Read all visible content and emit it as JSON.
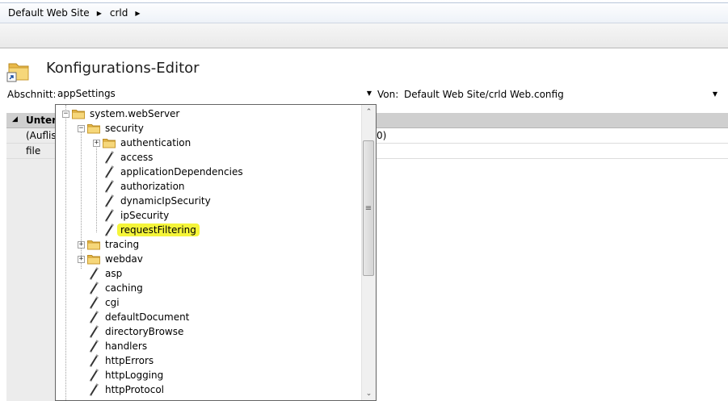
{
  "breadcrumb": [
    "Default Web Site",
    "crld"
  ],
  "feature": {
    "title": "Konfigurations-Editor"
  },
  "section": {
    "label": "Abschnitt:",
    "value": "appSettings"
  },
  "from": {
    "label": "Von:",
    "value": "Default Web Site/crld Web.config"
  },
  "grid": {
    "header": "Unters",
    "rows": [
      {
        "name": "(Auflist",
        "value": "0)"
      },
      {
        "name": "file",
        "value": ""
      }
    ]
  },
  "tree": [
    {
      "label": "system.webServer",
      "type": "folder",
      "expander": "−"
    },
    {
      "label": "security",
      "type": "folder",
      "expander": "−"
    },
    {
      "label": "authentication",
      "type": "folder",
      "expander": "+"
    },
    {
      "label": "access",
      "type": "leaf"
    },
    {
      "label": "applicationDependencies",
      "type": "leaf"
    },
    {
      "label": "authorization",
      "type": "leaf"
    },
    {
      "label": "dynamicIpSecurity",
      "type": "leaf"
    },
    {
      "label": "ipSecurity",
      "type": "leaf"
    },
    {
      "label": "requestFiltering",
      "type": "leaf",
      "highlighted": true
    },
    {
      "label": "tracing",
      "type": "folder",
      "expander": "+"
    },
    {
      "label": "webdav",
      "type": "folder",
      "expander": "+"
    },
    {
      "label": "asp",
      "type": "leaf"
    },
    {
      "label": "caching",
      "type": "leaf"
    },
    {
      "label": "cgi",
      "type": "leaf"
    },
    {
      "label": "defaultDocument",
      "type": "leaf"
    },
    {
      "label": "directoryBrowse",
      "type": "leaf"
    },
    {
      "label": "handlers",
      "type": "leaf"
    },
    {
      "label": "httpErrors",
      "type": "leaf"
    },
    {
      "label": "httpLogging",
      "type": "leaf"
    },
    {
      "label": "httpProtocol",
      "type": "leaf"
    }
  ],
  "colors": {
    "highlight": "#f5f53a",
    "folder": "#f3cd62"
  }
}
